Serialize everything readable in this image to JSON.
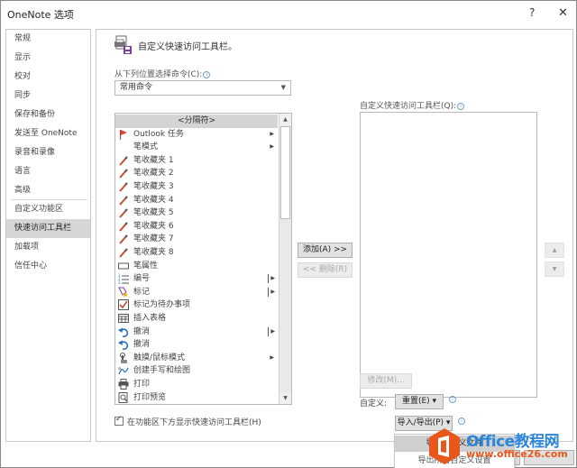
{
  "window": {
    "title": "OneNote 选项",
    "help_label": "?",
    "close_label": "✕"
  },
  "sidebar": {
    "items": [
      {
        "label": "常规",
        "active": false
      },
      {
        "label": "显示",
        "active": false
      },
      {
        "label": "校对",
        "active": false
      },
      {
        "label": "同步",
        "active": false
      },
      {
        "label": "保存和备份",
        "active": false
      },
      {
        "label": "发送至 OneNote",
        "active": false
      },
      {
        "label": "录音和录像",
        "active": false
      },
      {
        "label": "语言",
        "active": false
      },
      {
        "label": "高级",
        "active": false
      },
      {
        "label": "自定义功能区",
        "active": false
      },
      {
        "label": "快速访问工具栏",
        "active": true
      },
      {
        "label": "加载项",
        "active": false
      },
      {
        "label": "信任中心",
        "active": false
      }
    ]
  },
  "main": {
    "header_title": "自定义快速访问工具栏。",
    "choose_label": "从下列位置选择命令(C):",
    "info_glyph": "i",
    "choose_value": "常用命令",
    "commands": [
      {
        "label": "<分隔符>",
        "icon": "separator",
        "submenu": false,
        "selected": true
      },
      {
        "label": "Outlook 任务",
        "icon": "flag-icon",
        "submenu": true
      },
      {
        "label": "笔模式",
        "icon": "none",
        "submenu": true
      },
      {
        "label": "笔收藏夹 1",
        "icon": "pen-icon",
        "submenu": false
      },
      {
        "label": "笔收藏夹 2",
        "icon": "pen-icon",
        "submenu": false
      },
      {
        "label": "笔收藏夹 3",
        "icon": "pen-icon",
        "submenu": false
      },
      {
        "label": "笔收藏夹 4",
        "icon": "pen-icon",
        "submenu": false
      },
      {
        "label": "笔收藏夹 5",
        "icon": "pen-icon",
        "submenu": false
      },
      {
        "label": "笔收藏夹 6",
        "icon": "pen-icon",
        "submenu": false
      },
      {
        "label": "笔收藏夹 7",
        "icon": "pen-icon",
        "submenu": false
      },
      {
        "label": "笔收藏夹 8",
        "icon": "pen-icon",
        "submenu": false
      },
      {
        "label": "笔属性",
        "icon": "rectangle-icon",
        "submenu": false
      },
      {
        "label": "编号",
        "icon": "numbering-icon",
        "submenu": true,
        "bar": true
      },
      {
        "label": "标记",
        "icon": "tag-icon",
        "submenu": true,
        "bar": true
      },
      {
        "label": "标记为待办事项",
        "icon": "checkbox-icon",
        "submenu": false
      },
      {
        "label": "插入表格",
        "icon": "table-icon",
        "submenu": false
      },
      {
        "label": "撤消",
        "icon": "undo-icon",
        "submenu": true,
        "bar": true
      },
      {
        "label": "撤消",
        "icon": "undo-icon",
        "submenu": false
      },
      {
        "label": "触摸/鼠标模式",
        "icon": "touch-icon",
        "submenu": true
      },
      {
        "label": "创建手写和绘图",
        "icon": "ink-icon",
        "submenu": false
      },
      {
        "label": "打印",
        "icon": "printer-icon",
        "submenu": false
      },
      {
        "label": "打印预览",
        "icon": "print-preview-icon",
        "submenu": false
      }
    ],
    "show_below_ribbon_label": "在功能区下方显示快速访问工具栏(H)",
    "show_below_ribbon_checked": true,
    "add_button": "添加(A) >>",
    "remove_button": "<< 删除(R)",
    "qat_label": "自定义快速访问工具栏(Q):",
    "qat_items": [],
    "move_up": "▲",
    "move_down": "▼",
    "modify_button": "修改(M)...",
    "customize_label": "自定义:",
    "reset_button": "重置(E) ▾",
    "import_export_button": "导入/导出(P) ▾",
    "dropdown_items": [
      {
        "label": "导入自定义文件",
        "hover": true
      },
      {
        "label": "导出所有自定义设置",
        "hover": false
      }
    ]
  },
  "watermark": {
    "text": "Office教程网",
    "url": "www.office26.com"
  },
  "colors": {
    "active_sidebar": "#d6d6d6",
    "info_blue": "#6a9fd8",
    "watermark_blue": "#2b86d9",
    "watermark_orange": "#e8571c"
  }
}
